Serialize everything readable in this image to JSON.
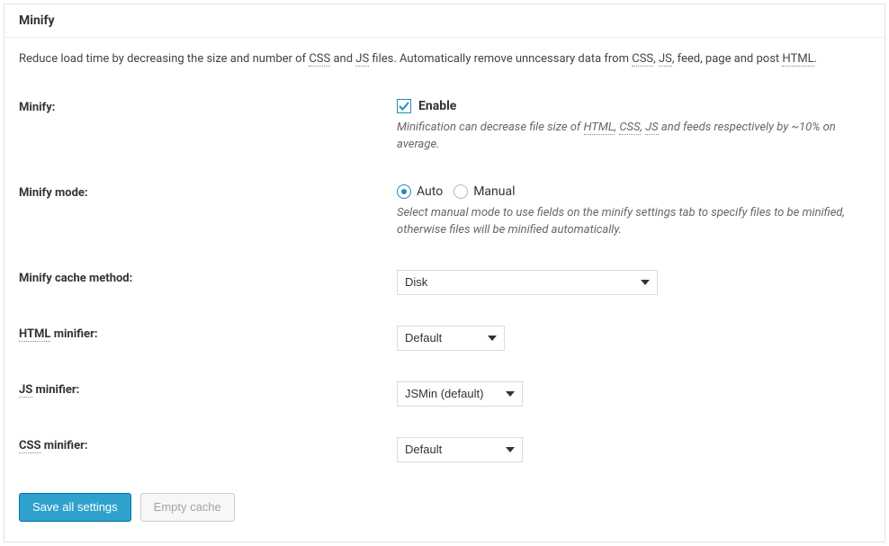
{
  "panel": {
    "title": "Minify",
    "intro_parts": {
      "p1": "Reduce load time by decreasing the size and number of ",
      "abbr_css": "CSS",
      "p2": " and ",
      "abbr_js": "JS",
      "p3": " files. Automatically remove unncessary data from ",
      "abbr_css2": "CSS",
      "p4": ", ",
      "abbr_js2": "JS",
      "p5": ", feed, page and post ",
      "abbr_html": "HTML",
      "p6": "."
    }
  },
  "rows": {
    "minify": {
      "label": "Minify:",
      "enable_label": "Enable",
      "checked": true,
      "help_parts": {
        "p1": "Minification can decrease file size of ",
        "abbr_html": "HTML",
        "p2": ", ",
        "abbr_css": "CSS",
        "p3": ", ",
        "abbr_js": "JS",
        "p4": " and feeds respectively by ~10% on average."
      }
    },
    "mode": {
      "label": "Minify mode:",
      "auto_label": "Auto",
      "manual_label": "Manual",
      "selected": "auto",
      "help": "Select manual mode to use fields on the minify settings tab to specify files to be minified, otherwise files will be minified automatically."
    },
    "cache_method": {
      "label": "Minify cache method:",
      "value": "Disk"
    },
    "html_minifier": {
      "label_abbr": "HTML",
      "label_rest": " minifier:",
      "value": "Default"
    },
    "js_minifier": {
      "label_abbr": "JS",
      "label_rest": " minifier:",
      "value": "JSMin (default)"
    },
    "css_minifier": {
      "label_abbr": "CSS",
      "label_rest": " minifier:",
      "value": "Default"
    }
  },
  "buttons": {
    "save": "Save all settings",
    "empty": "Empty cache"
  }
}
